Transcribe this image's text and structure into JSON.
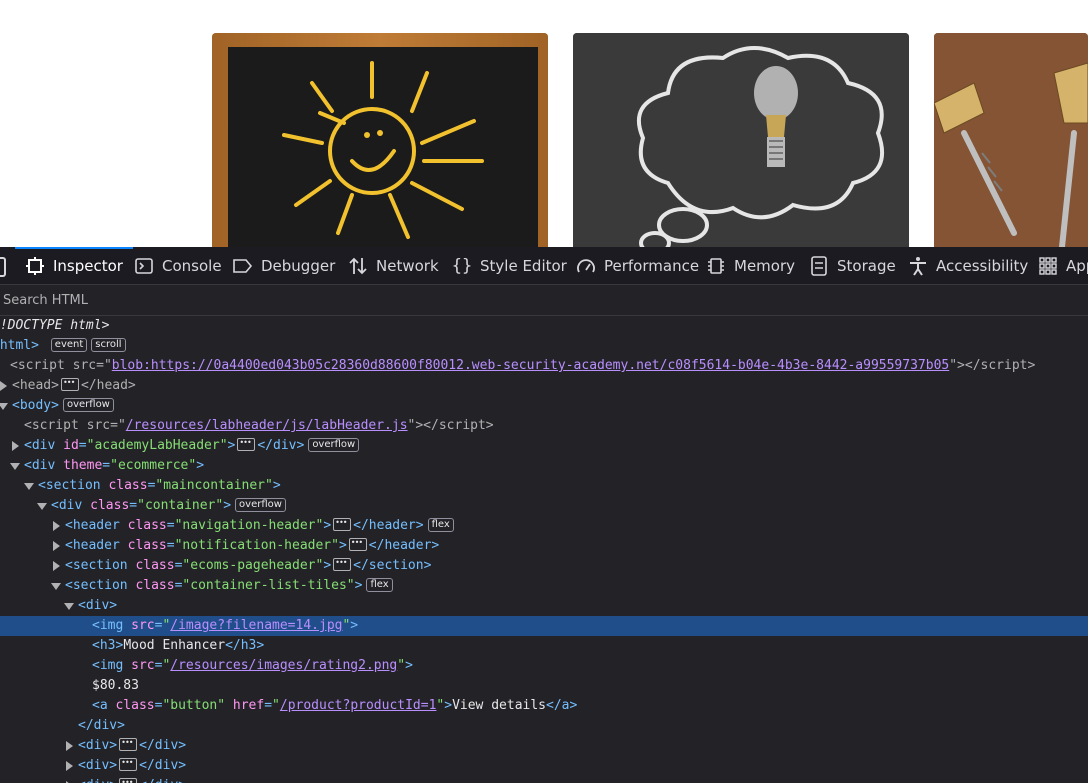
{
  "devtools": {
    "tabs": [
      {
        "label": "Inspector",
        "icon": "inspector-icon",
        "active": true
      },
      {
        "label": "Console",
        "icon": "console-icon"
      },
      {
        "label": "Debugger",
        "icon": "debugger-icon"
      },
      {
        "label": "Network",
        "icon": "network-icon"
      },
      {
        "label": "Style Editor",
        "icon": "style-editor-icon"
      },
      {
        "label": "Performance",
        "icon": "performance-icon"
      },
      {
        "label": "Memory",
        "icon": "memory-icon"
      },
      {
        "label": "Storage",
        "icon": "storage-icon"
      },
      {
        "label": "Accessibility",
        "icon": "accessibility-icon"
      },
      {
        "label": "App",
        "icon": "application-icon"
      }
    ],
    "search_placeholder": "Search HTML",
    "accent_color": "#0a84ff",
    "selection_color": "#204e8a"
  },
  "tree": {
    "doctype": "<!DOCTYPE html>",
    "script_blob_src": "blob:https://0a4400ed043b05c28360d88600f80012.web-security-academy.net/c08f5614-b04e-4b3e-8442-a99559737b05",
    "labheader_src": "/resources/labheader/js/labHeader.js",
    "academy_id": "academyLabHeader",
    "theme": "ecommerce",
    "section_main_class": "maincontainer",
    "container_class": "container",
    "nav_header_class": "navigation-header",
    "notification_header_class": "notification-header",
    "pageheader_class": "ecoms-pageheader",
    "list_tiles_class": "container-list-tiles",
    "img_src": "/image?filename=14.jpg",
    "h3_text": "Mood Enhancer",
    "rating_src": "/resources/images/rating2.png",
    "price": "$80.83",
    "a_class": "button",
    "a_href": "/product?productId=1",
    "a_text": "View details"
  },
  "badges": {
    "event": "event",
    "scroll": "scroll",
    "overflow": "overflow",
    "flex": "flex"
  }
}
